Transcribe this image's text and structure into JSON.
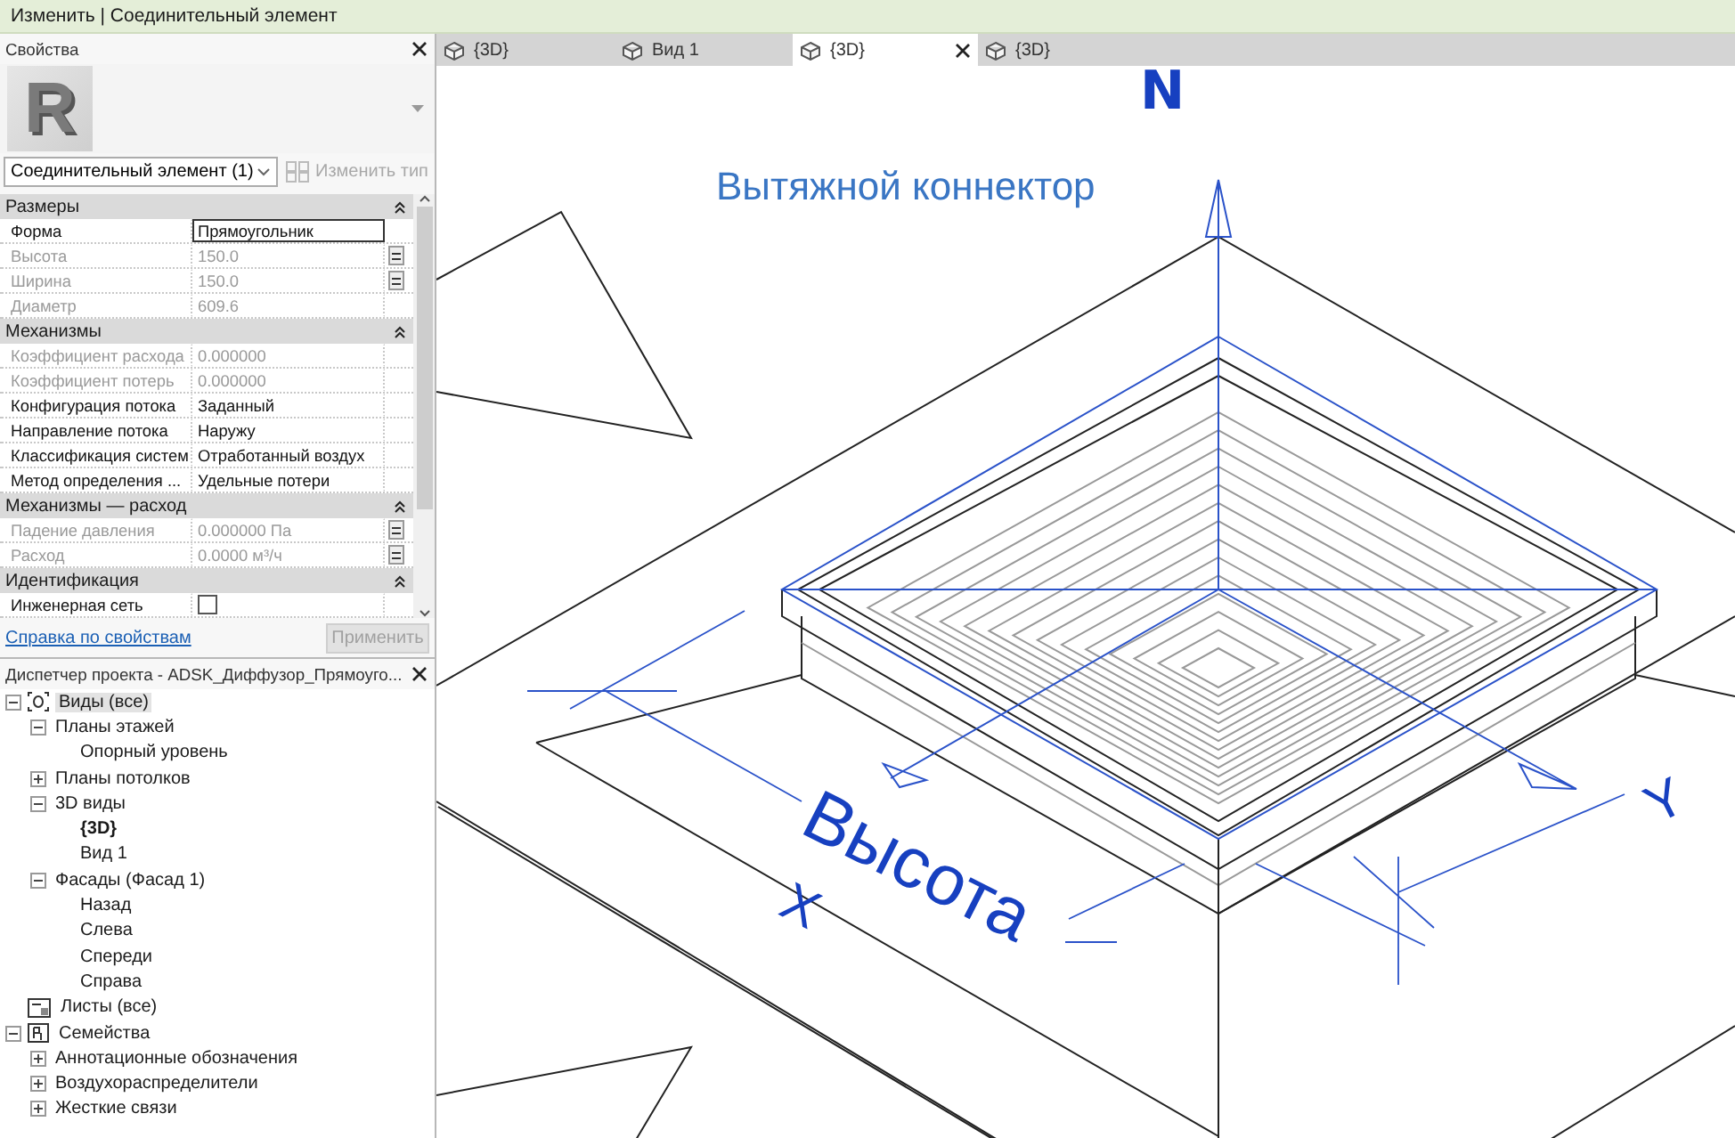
{
  "context_bar": {
    "title": "Изменить | Соединительный элемент"
  },
  "properties": {
    "title": "Свойства",
    "type_image_letter": "R",
    "type_selector": "Соединительный элемент (1)",
    "edit_type_button": {
      "label": "Изменить тип",
      "disabled": true
    },
    "groups": [
      {
        "label": "Размеры",
        "expanded": true,
        "rows": [
          {
            "kind": "field",
            "label": "Форма",
            "value": "Прямоугольник",
            "editable": true,
            "linked": false
          },
          {
            "kind": "text",
            "label": "Высота",
            "value": "150.0",
            "editable": false,
            "linked": true
          },
          {
            "kind": "text",
            "label": "Ширина",
            "value": "150.0",
            "editable": false,
            "linked": true
          },
          {
            "kind": "text",
            "label": "Диаметр",
            "value": "609.6",
            "editable": false,
            "linked": false
          }
        ]
      },
      {
        "label": "Механизмы",
        "expanded": true,
        "rows": [
          {
            "kind": "text",
            "label": "Коэффициент расхода",
            "value": "0.000000",
            "editable": false,
            "linked": false
          },
          {
            "kind": "text",
            "label": "Коэффициент потерь",
            "value": "0.000000",
            "editable": false,
            "linked": false
          },
          {
            "kind": "text",
            "label": "Конфигурация потока",
            "value": "Заданный",
            "editable": true,
            "linked": false
          },
          {
            "kind": "text",
            "label": "Направление потока",
            "value": "Наружу",
            "editable": true,
            "linked": false
          },
          {
            "kind": "text",
            "label": "Классификация систем",
            "value": "Отработанный воздух",
            "editable": true,
            "linked": false
          },
          {
            "kind": "text",
            "label": "Метод определения ...",
            "value": "Удельные потери",
            "editable": true,
            "linked": false
          }
        ]
      },
      {
        "label": "Механизмы — расход",
        "expanded": true,
        "rows": [
          {
            "kind": "text",
            "label": "Падение давления",
            "value": "0.000000 Па",
            "editable": false,
            "linked": true
          },
          {
            "kind": "text",
            "label": "Расход",
            "value": "0.0000 м³/ч",
            "editable": false,
            "linked": true
          }
        ]
      },
      {
        "label": "Идентификация",
        "expanded": true,
        "rows": [
          {
            "kind": "checkbox",
            "label": "Инженерная сеть",
            "checked": false,
            "editable": true,
            "linked": false
          }
        ]
      }
    ],
    "help_link": "Справка по свойствам",
    "apply_button": {
      "label": "Применить",
      "disabled": true
    }
  },
  "project_browser": {
    "title": "Диспетчер проекта - ADSK_Диффузор_Прямоуго...",
    "tree": [
      {
        "kind": "views",
        "label": "Виды (все)",
        "expanded": true,
        "selected": true,
        "active_view": false,
        "children": [
          {
            "label": "Планы этажей",
            "expanded": true,
            "selected": false,
            "active_view": false,
            "children": [
              {
                "label": "Опорный уровень",
                "selected": false,
                "active_view": false
              }
            ]
          },
          {
            "label": "Планы потолков",
            "expanded": false,
            "selected": false,
            "active_view": false
          },
          {
            "label": "3D виды",
            "expanded": true,
            "selected": false,
            "active_view": false,
            "children": [
              {
                "label": "{3D}",
                "selected": false,
                "active_view": true
              },
              {
                "label": "Вид 1",
                "selected": false,
                "active_view": false
              }
            ]
          },
          {
            "label": "Фасады (Фасад 1)",
            "expanded": true,
            "selected": false,
            "active_view": false,
            "children": [
              {
                "label": "Назад",
                "selected": false,
                "active_view": false
              },
              {
                "label": "Слева",
                "selected": false,
                "active_view": false
              },
              {
                "label": "Спереди",
                "selected": false,
                "active_view": false
              },
              {
                "label": "Справа",
                "selected": false,
                "active_view": false
              }
            ]
          }
        ]
      },
      {
        "kind": "sheets",
        "label": "Листы (все)",
        "selected": false,
        "active_view": false
      },
      {
        "kind": "families",
        "label": "Семейства",
        "expanded": true,
        "selected": false,
        "active_view": false,
        "children": [
          {
            "label": "Аннотационные обозначения",
            "expanded": false,
            "selected": false,
            "active_view": false
          },
          {
            "label": "Воздухораспределители",
            "expanded": false,
            "selected": false,
            "active_view": false
          },
          {
            "label": "Жесткие связи",
            "expanded": false,
            "selected": false,
            "active_view": false
          }
        ]
      }
    ]
  },
  "view_tabs": [
    {
      "label": "{3D}",
      "selected": false,
      "closable": false
    },
    {
      "label": "Вид 1",
      "selected": false,
      "closable": false
    },
    {
      "label": "{3D}",
      "selected": true,
      "closable": true
    },
    {
      "label": "{3D}",
      "selected": false,
      "closable": false
    }
  ],
  "canvas": {
    "north_label": "N",
    "connector_label": "Вытяжной коннектор",
    "dimension_label": "Высота",
    "axis_labels": [
      "X",
      "Y"
    ]
  }
}
